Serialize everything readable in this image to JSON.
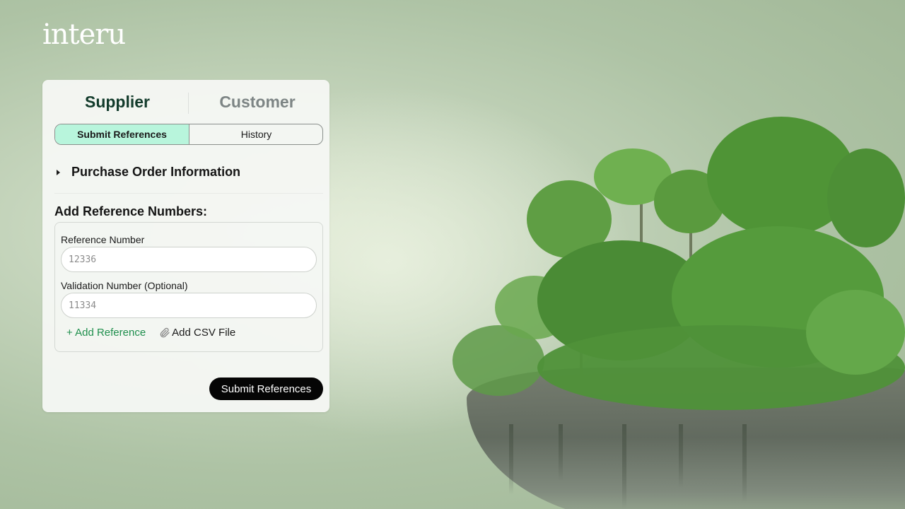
{
  "brand": {
    "logo_text": "interu"
  },
  "roles": {
    "supplier": "Supplier",
    "customer": "Customer"
  },
  "subtabs": {
    "submit": "Submit References",
    "history": "History"
  },
  "sections": {
    "purchase_order": "Purchase Order Information"
  },
  "form": {
    "title": "Add Reference Numbers:",
    "reference_label": "Reference Number",
    "reference_placeholder": "12336",
    "validation_label": "Validation Number (Optional)",
    "validation_placeholder": "11334",
    "add_reference": "+ Add Reference",
    "add_csv": "Add CSV File",
    "submit": "Submit References"
  },
  "colors": {
    "accent_tab": "#b8f5dc",
    "add_link": "#1f8f4d",
    "active_role": "#123b2b",
    "submit_bg": "#050505"
  }
}
